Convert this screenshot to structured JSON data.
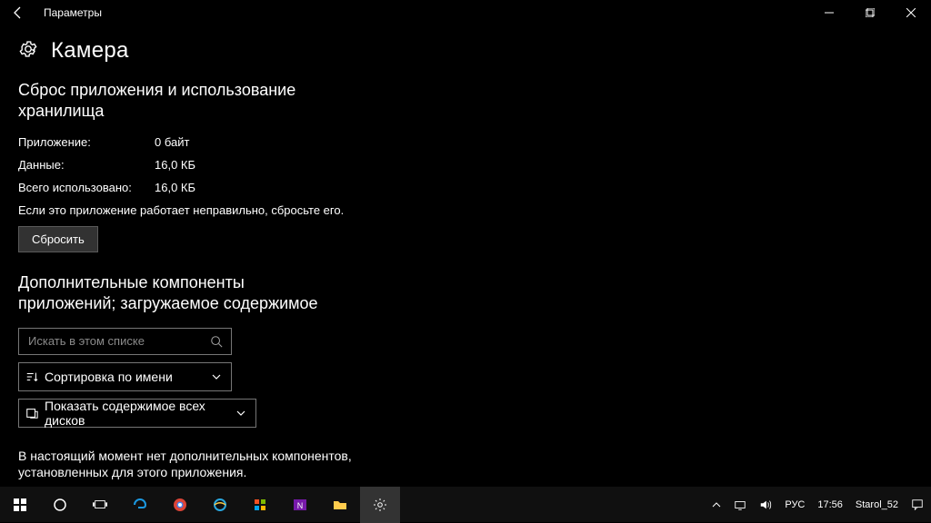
{
  "titlebar": {
    "title": "Параметры"
  },
  "header": {
    "page_title": "Камера"
  },
  "section_reset": {
    "title": "Сброс приложения и использование хранилища",
    "rows": {
      "app_label": "Приложение:",
      "app_value": "0 байт",
      "data_label": "Данные:",
      "data_value": "16,0 КБ",
      "total_label": "Всего использовано:",
      "total_value": "16,0 КБ"
    },
    "help": "Если это приложение работает неправильно, сбросьте его.",
    "button": "Сбросить"
  },
  "section_addons": {
    "title_line1": "Дополнительные компоненты",
    "title_line2": "приложений; загружаемое содержимое",
    "search_placeholder": "Искать в этом списке",
    "sort_label": "Сортировка по имени",
    "drives_label": "Показать содержимое всех дисков",
    "empty_line1": "В настоящий момент нет дополнительных компонентов,",
    "empty_line2": "установленных для этого приложения."
  },
  "taskbar": {
    "lang": "РУС",
    "time": "17:56",
    "user": "Starol_52"
  }
}
